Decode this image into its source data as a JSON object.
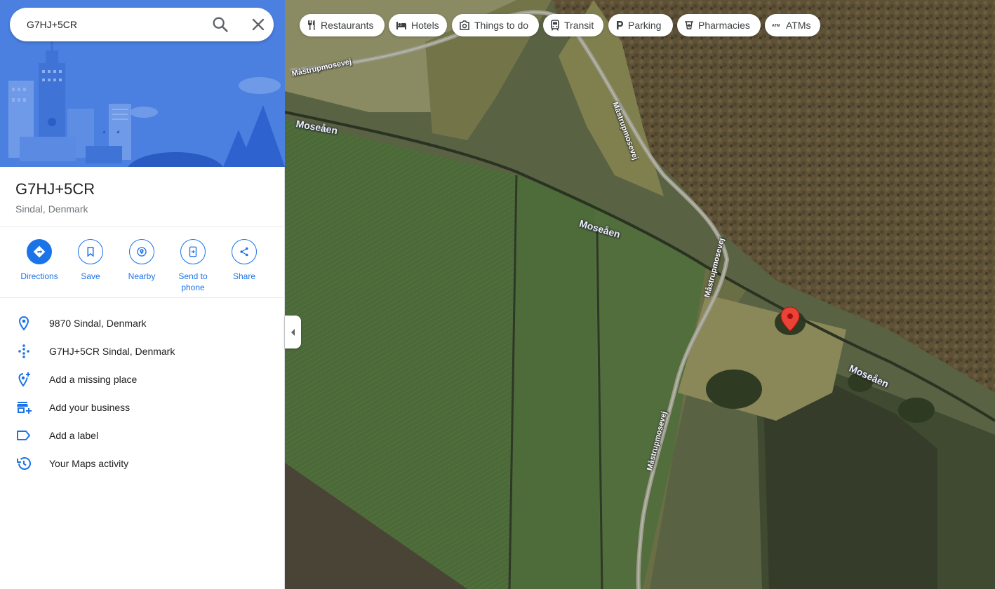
{
  "search": {
    "value": "G7HJ+5CR"
  },
  "place": {
    "title": "G7HJ+5CR",
    "subtitle": "Sindal, Denmark"
  },
  "actions": [
    {
      "label": "Directions",
      "icon": "directions-icon"
    },
    {
      "label": "Save",
      "icon": "bookmark-icon"
    },
    {
      "label": "Nearby",
      "icon": "nearby-icon"
    },
    {
      "label": "Send to\nphone",
      "icon": "send-to-phone-icon"
    },
    {
      "label": "Share",
      "icon": "share-icon"
    }
  ],
  "info_rows": [
    {
      "text": "9870 Sindal, Denmark",
      "icon": "location-pin-icon"
    },
    {
      "text": "G7HJ+5CR Sindal, Denmark",
      "icon": "plus-code-icon"
    },
    {
      "text": "Add a missing place",
      "icon": "add-place-icon"
    },
    {
      "text": "Add your business",
      "icon": "add-business-icon"
    },
    {
      "text": "Add a label",
      "icon": "label-icon"
    },
    {
      "text": "Your Maps activity",
      "icon": "history-icon"
    }
  ],
  "chips": [
    {
      "label": "Restaurants",
      "icon": "restaurant-icon"
    },
    {
      "label": "Hotels",
      "icon": "hotel-icon"
    },
    {
      "label": "Things to do",
      "icon": "camera-icon"
    },
    {
      "label": "Transit",
      "icon": "transit-icon"
    },
    {
      "label": "Parking",
      "icon": "parking-icon"
    },
    {
      "label": "Pharmacies",
      "icon": "pharmacy-icon"
    },
    {
      "label": "ATMs",
      "icon": "atm-icon"
    }
  ],
  "map_labels": {
    "road_1": "Måstrupmosevej",
    "road_2": "Måstrupmosevej",
    "road_3": "Måstrupmosevej",
    "road_4": "Måstrupmosevej",
    "water_1": "Moseåen",
    "water_2": "Moseåen",
    "water_3": "Moseåen"
  },
  "colors": {
    "accent": "#1a73e8",
    "marker": "#ea4335",
    "hero_bg": "#4a7fe0"
  }
}
